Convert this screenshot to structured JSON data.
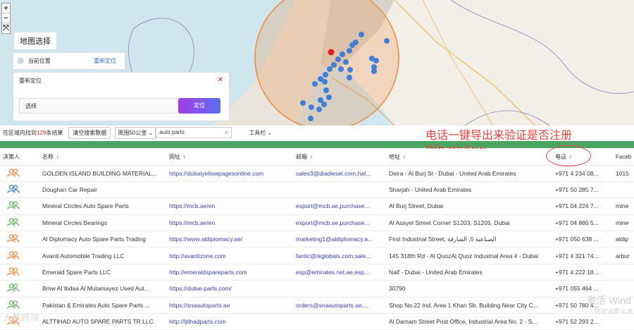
{
  "map": {
    "zoom": {
      "in": "+",
      "out": "−",
      "fit": "⤧"
    },
    "title": "地图选择",
    "current_location_label": "当前位置",
    "relocate_link": "重新定位",
    "relocate_title": "重新定位",
    "close": "✕",
    "select_placeholder": "选择",
    "locate_button": "定位"
  },
  "toolbar": {
    "found_prefix": "在区域内找到",
    "found_count": "129",
    "found_suffix": "条结果",
    "clear_button": "清空搜索数据",
    "radius_select": "周围50公里",
    "search_value": "auto parts",
    "tools_menu": "工具栏"
  },
  "overlay": {
    "line1": "电话一键导出来验证是否注册",
    "line2": "WhatsApp"
  },
  "table": {
    "headers": [
      "决策人",
      "名称",
      "网址",
      "邮箱",
      "地址",
      "电话",
      "Faceb"
    ],
    "rows": [
      {
        "person": "orange",
        "name": "GOLDEN ISLAND BUILDING MATERIAL...",
        "site": "https://dubaiyellowpagesonline.com",
        "email": "sales3@diadiesel.com,haf...",
        "addr": "Deira - Al Burj St - Dubai - United Arab Emirates",
        "phone": "+971 4 234 08...",
        "fb": "1015"
      },
      {
        "person": "blue",
        "name": "Doughan Car Repair",
        "site": "",
        "email": "",
        "addr": "Sharjah - United Arab Emirates",
        "phone": "+971 50 285 7...",
        "fb": ""
      },
      {
        "person": "green",
        "name": "Mineral Circles Auto Spare Parts",
        "site": "https://mcb.ae/en",
        "email": "export@mcb.ae,purchase...",
        "addr": "Al Burj Street, Dubai",
        "phone": "+971 04 224 7...",
        "fb": "mine"
      },
      {
        "person": "green",
        "name": "Mineral Circles Bearings",
        "site": "https://mcb.ae/en",
        "email": "export@mcb.ae,purchase...",
        "addr": "Al Asayel Street Corner S1203, S1205, Dubai",
        "phone": "+971 04 886 5...",
        "fb": "mine"
      },
      {
        "person": "orange",
        "name": "Al Diplomacy Auto Spare Parts Trading",
        "site": "https://www.aldiplomacy.ae/",
        "email": "marketing1@aldiplomacy.a...",
        "addr": "First Industrial Street, الصناعية 5, الشارقة",
        "phone": "+971 050 638 ...",
        "fb": "aldip"
      },
      {
        "person": "orange",
        "name": "Avanti Automobile Trading LLC",
        "site": "http://avantizone.com",
        "email": "fantic@rkglobals.com,sale...",
        "addr": "145 318th Rd - Al QuozAl Quoz Industrial Area 4 - Dubai",
        "phone": "+971 4 321 74...",
        "fb": "arbur"
      },
      {
        "person": "orange",
        "name": "Emerald Spare Parts LLC",
        "site": "http://emeraldspareparts.com",
        "email": "esp@emirates.net.ae,esp...",
        "addr": "Naif - Dubai - United Arab Emirates",
        "phone": "+971 4 222 18...",
        "fb": ""
      },
      {
        "person": "green",
        "name": "Bmw Al Ibdaa Al Mutamayez Used Aut...",
        "site": "https://dubai-parts.com/",
        "email": "",
        "addr": "30790",
        "phone": "+971 055 464 ...",
        "fb": ""
      },
      {
        "person": "green",
        "name": "Pakistan & Emirates Auto Spare Parts ...",
        "site": "https://snaautoparts.ae",
        "email": "orders@snaautoparts.ae,...",
        "addr": "Shop No.22 Ind. Area 1 Khan Sb. Building Near City C...",
        "phone": "+971 50 780 4...",
        "fb": ""
      },
      {
        "person": "orange",
        "name": "ALTTIHAD AUTO SPARE PARTS TR.LLC",
        "site": "http://ljtihadparts.com",
        "email": "",
        "addr": "Al Damam Street Post Office, Industrial Area No. 2 - S...",
        "phone": "+971 52 293 2...",
        "fb": ""
      }
    ]
  },
  "watermark": {
    "line1": "激活 Wind",
    "line2": "转到\"设置\"以激"
  },
  "logo_text": "大数跨境",
  "colors": {
    "accent": "#3a3fb3",
    "red": "#e8453c",
    "green_bar": "#4aa562",
    "orange_person": "#f08a3c",
    "blue_person": "#3f7fd8",
    "green_person": "#5cb85c"
  }
}
